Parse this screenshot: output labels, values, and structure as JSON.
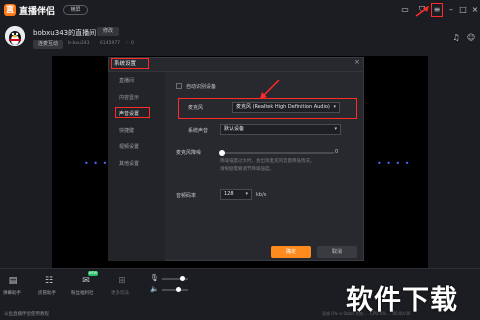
{
  "header": {
    "logo_glyph": "直",
    "app_title": "直播伴侣",
    "mode_pill": "横屏",
    "icons": [
      "picture-in-picture-icon",
      "shirt-icon",
      "menu-icon",
      "minimize-icon",
      "maximize-icon",
      "close-icon"
    ]
  },
  "profile": {
    "room_title": "bobxu343的直播间",
    "edit_label": "修改",
    "interact_label": "连麦互动",
    "meta_id": "b-bxu343",
    "meta_num": "6145977",
    "meta_count": "0"
  },
  "dialog": {
    "title": "系统设置",
    "close_glyph": "×",
    "side_items": [
      "直播间",
      "内容显示",
      "声音设置",
      "快捷键",
      "视频设置",
      "其他设置"
    ],
    "auto_open_label": "自动识别设备",
    "mic_label": "麦克风",
    "mic_value": "麦克风 (Realtek High Definition Audio)",
    "system_sound_label": "系统声音",
    "system_sound_value": "默认设备",
    "noise_label": "麦克风降噪",
    "noise_value": "0",
    "noise_hint_1": "降噪强度过大时，会出现麦克风音量降低情况。",
    "noise_hint_2": "请根据需要调节降噪强度。",
    "bitrate_label": "音频码率",
    "bitrate_value": "128",
    "bitrate_unit": "kb/s",
    "ok_label": "确定",
    "cancel_label": "取消"
  },
  "bottom": {
    "tools": [
      {
        "label": "弹幕助手",
        "icon": "danmaku-icon"
      },
      {
        "label": "房管助手",
        "icon": "admin-icon"
      },
      {
        "label": "粉丝福利社",
        "icon": "gift-icon"
      },
      {
        "label": "更多玩法",
        "icon": "more-icon"
      }
    ],
    "new_badge": "NEW",
    "footer_tip": "斗鱼直播伴侣使用教程",
    "status": "丢帧 0%  ⟲ 0kb/s  内存 …   CPU 0%  …  00:00:00",
    "watermark": "软件下载"
  },
  "colors": {
    "accent": "#ff8a1e",
    "highlight": "#ff2a2a",
    "dots": "#4a62ff"
  }
}
